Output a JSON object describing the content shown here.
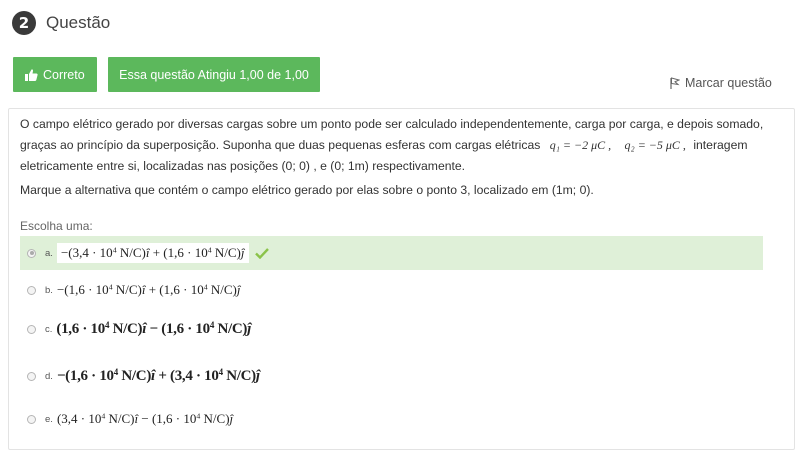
{
  "question": {
    "number": "2",
    "title": "Questão",
    "status_label": "Correto",
    "grade_label": "Essa questão Atingiu 1,00 de 1,00",
    "flag_label": "Marcar questão",
    "text": {
      "p1_part1": "O campo elétrico gerado por diversas cargas sobre um ponto pode ser calculado independentemente, carga por carga, e depois somado, graças ao princípio da superposição. Suponha que duas pequenas esferas com cargas elétricas",
      "q1": "q₁ = −2 μC ,",
      "q2": "q₂ = −5 μC ,",
      "p1_part2": "interagem eletricamente entre si, localizadas nas posições (0; 0) , e (0; 1m) respectivamente.",
      "p2": "Marque a alternativa que contém o campo elétrico gerado por elas sobre o ponto 3, localizado em (1m; 0)."
    },
    "choose_label": "Escolha uma:",
    "answers": [
      {
        "letter": "a.",
        "t1": "−(3,4 · 10",
        "e1": "4",
        "t2": " N/C)",
        "h1": "î",
        "t3": " + (1,6 · 10",
        "e2": "4",
        "t4": " N/C)",
        "h2": "ĵ",
        "selected": true,
        "correct": true
      },
      {
        "letter": "b.",
        "t1": "−(1,6 · 10",
        "e1": "4",
        "t2": " N/C)",
        "h1": "î",
        "t3": " + (1,6 · 10",
        "e2": "4",
        "t4": " N/C)",
        "h2": "ĵ",
        "selected": false,
        "correct": false
      },
      {
        "letter": "c.",
        "t1": "(1,6 · 10",
        "e1": "4",
        "t2": " N/C)",
        "h1": "î",
        "t3": " − (1,6 · 10",
        "e2": "4",
        "t4": " N/C)",
        "h2": "ĵ",
        "selected": false,
        "correct": false
      },
      {
        "letter": "d.",
        "t1": "−(1,6 · 10",
        "e1": "4",
        "t2": " N/C)",
        "h1": "î",
        "t3": " + (3,4 · 10",
        "e2": "4",
        "t4": " N/C)",
        "h2": "ĵ",
        "selected": false,
        "correct": false
      },
      {
        "letter": "e.",
        "t1": "(3,4 · 10",
        "e1": "4",
        "t2": " N/C)",
        "h1": "î",
        "t3": " − (1,6 · 10",
        "e2": "4",
        "t4": " N/C)",
        "h2": "ĵ",
        "selected": false,
        "correct": false
      }
    ]
  },
  "colors": {
    "success_green": "#5cb85c",
    "correct_row_bg": "#dff0d8",
    "check_green": "#8bc34a"
  },
  "icons": {
    "status": "thumbs-up-icon",
    "flag": "flag-icon",
    "correct": "check-icon"
  }
}
